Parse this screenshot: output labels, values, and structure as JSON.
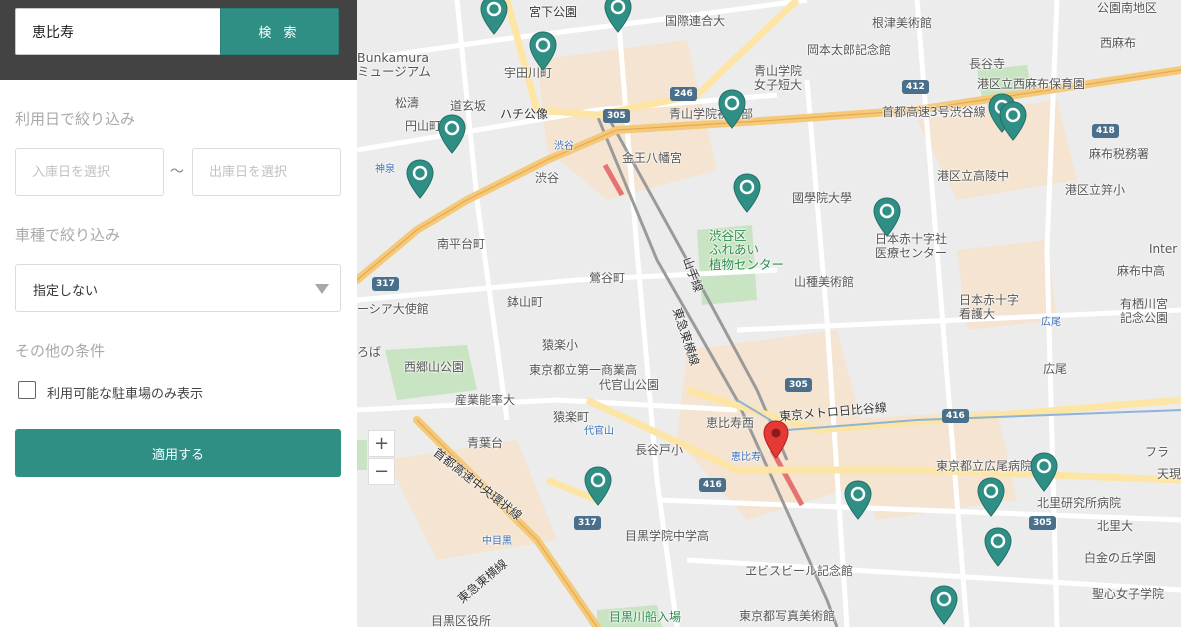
{
  "search": {
    "value": "恵比寿",
    "button_label": "検 索"
  },
  "filters": {
    "date_title": "利用日で絞り込み",
    "entry_placeholder": "入庫日を選択",
    "exit_placeholder": "出庫日を選択",
    "date_separator": "〜",
    "car_type_title": "車種で絞り込み",
    "car_type_value": "指定しない",
    "other_title": "その他の条件",
    "available_only_label": "利用可能な駐車場のみ表示",
    "available_only_checked": false,
    "apply_label": "適用する"
  },
  "map": {
    "zoom_in_label": "+",
    "zoom_out_label": "−",
    "labels": {
      "miyashita": "宮下公園",
      "kokuren": "国際連合大",
      "nezu": "根津美術館",
      "nishiazabu": "西麻布",
      "bunkamura": "Bunkamura\nミュージアム",
      "udagawa": "宇田川町",
      "okamoto": "岡本太郎記念館",
      "minamiaoyama": "港区立西麻布保育園",
      "nagayaji": "長谷寺",
      "shoto": "松濤",
      "dogenzaka": "道玄坂",
      "aoyamagakuin": "青山学院\n女子短大",
      "maruyama": "円山町",
      "hachiko": "ハチ公像",
      "aoyamagakuin2": "青山学院初等部",
      "expressway3": "首都高速3号渋谷線",
      "shibuya_st": "渋谷",
      "kinno": "金王八幡宮",
      "hiroo": "広尾",
      "azabu_tax": "麻布税務署",
      "shinsen": "神泉",
      "shibuya_shield": "渋谷",
      "takadai": "港区立高陵中",
      "kokugakuin": "國學院大學",
      "shibuya_plants": "渋谷区\nふれあい\n植物センター",
      "nisseki": "日本赤十字社\n医療センター",
      "kogai": "港区立笄小",
      "minamihira": "南平台町",
      "azabu_jr": "麻布中高",
      "arisugawa": "有栖川宮\n記念公園",
      "uguisu": "鶯谷町",
      "yamatane": "山種美術館",
      "embassy": "ーシア大使館",
      "hachiyama": "鉢山町",
      "nisseki_univ": "日本赤十字\n看護大",
      "hiroo_st": "広尾",
      "yamanote": "山手線",
      "toyoko": "東急東横線",
      "sarugaku": "猿楽小",
      "saigo": "西郷山公園",
      "daiichi": "東京都立第一商業高",
      "daikanyama_park": "代官山公園",
      "hiroo2": "広尾",
      "sangyo": "産業能率大",
      "hibiya": "東京メトロ日比谷線",
      "ebisu_shrine": "恵比寿西",
      "saru_town": "猿楽町",
      "daikanyama": "代官山",
      "nagayato": "長谷戸小",
      "aoba": "青葉台",
      "ebisu_st": "恵比寿",
      "hiroo_hs": "東京都立広尾病院",
      "kitasato": "北里研究所病院",
      "chuo_exp": "首都高速中央環状線",
      "kitasato_univ": "北里大",
      "nakameguro": "中目黒",
      "megurogakuin": "目黒学院中学高",
      "shirokane": "白金の丘学園",
      "seishin": "聖心女子学院",
      "yebisu_beer": "ヱビスビール記念館",
      "toyoko2": "東急東横線",
      "meguro_boat": "目黒川船入場",
      "photomuseum": "東京都写真美術館",
      "meguro_ward": "目黒区役所",
      "inter": "Inter",
      "fura": "フラ",
      "tenmon": "天現",
      "roba": "ろば",
      "kohen": "公園南地区",
      "hiroo_station_sign": "広尾"
    },
    "route_shields": [
      "246",
      "305",
      "412",
      "418",
      "317",
      "305",
      "416",
      "416",
      "317",
      "305"
    ]
  },
  "colors": {
    "accent": "#2f8f85",
    "search_band": "#434343"
  }
}
